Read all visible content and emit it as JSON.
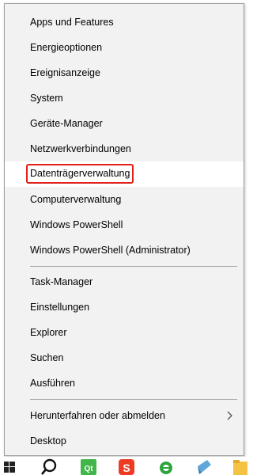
{
  "menu": {
    "group1": [
      {
        "label": "Apps und Features"
      },
      {
        "label": "Energieoptionen"
      },
      {
        "label": "Ereignisanzeige"
      },
      {
        "label": "System"
      },
      {
        "label": "Geräte-Manager"
      },
      {
        "label": "Netzwerkverbindungen"
      },
      {
        "label": "Datenträgerverwaltung"
      },
      {
        "label": "Computerverwaltung"
      },
      {
        "label": "Windows PowerShell"
      },
      {
        "label": "Windows PowerShell (Administrator)"
      }
    ],
    "group2": [
      {
        "label": "Task-Manager"
      },
      {
        "label": "Einstellungen"
      },
      {
        "label": "Explorer"
      },
      {
        "label": "Suchen"
      },
      {
        "label": "Ausführen"
      }
    ],
    "group3": [
      {
        "label": "Herunterfahren oder abmelden"
      },
      {
        "label": "Desktop"
      }
    ],
    "highlight_color": "#e0201b"
  },
  "taskbar": {
    "icons": [
      "windows-start-icon",
      "search-icon",
      "qt-creator-icon",
      "sogou-icon",
      "internet-explorer-icon",
      "notepad-icon",
      "folder-icon"
    ]
  }
}
